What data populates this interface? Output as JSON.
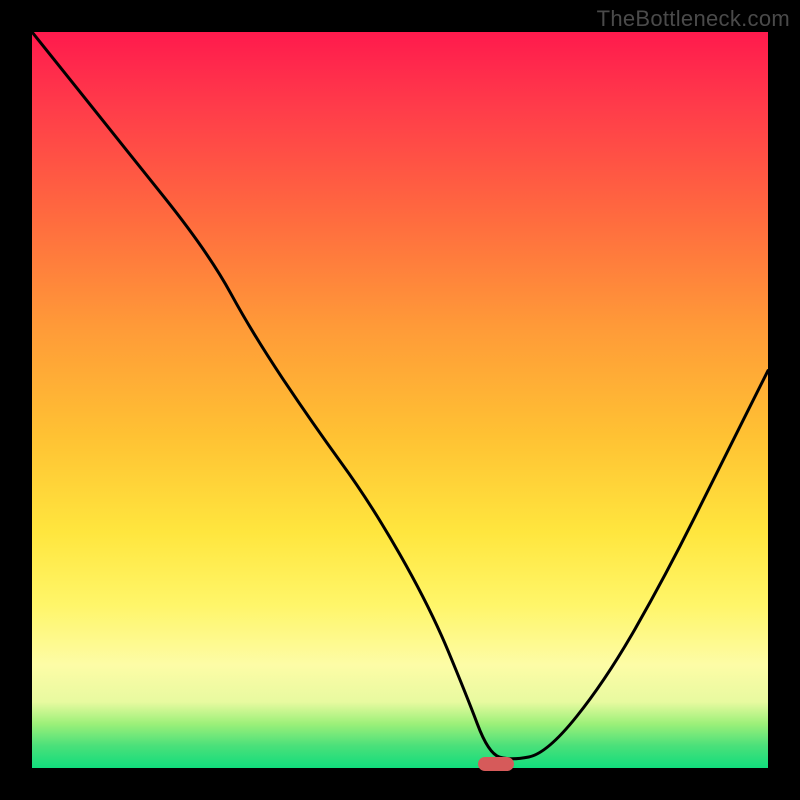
{
  "watermark": "TheBottleneck.com",
  "chart_data": {
    "type": "line",
    "title": "",
    "xlabel": "",
    "ylabel": "",
    "xlim": [
      0,
      100
    ],
    "ylim": [
      0,
      100
    ],
    "grid": false,
    "legend": false,
    "series": [
      {
        "name": "curve",
        "x": [
          0,
          12,
          24,
          30,
          38,
          46,
          54,
          59,
          62,
          65,
          70,
          78,
          86,
          94,
          100
        ],
        "values": [
          100,
          85,
          70,
          59,
          47,
          36,
          22,
          10,
          2,
          1,
          2,
          12,
          26,
          42,
          54
        ]
      }
    ],
    "marker": {
      "x": 63,
      "y": 0.5,
      "color": "#d65a5a"
    },
    "gradient_stops": [
      {
        "pct": 0,
        "color": "#ff1a4d"
      },
      {
        "pct": 55,
        "color": "#ffc233"
      },
      {
        "pct": 86,
        "color": "#fdfca6"
      },
      {
        "pct": 100,
        "color": "#11dd7c"
      }
    ]
  }
}
